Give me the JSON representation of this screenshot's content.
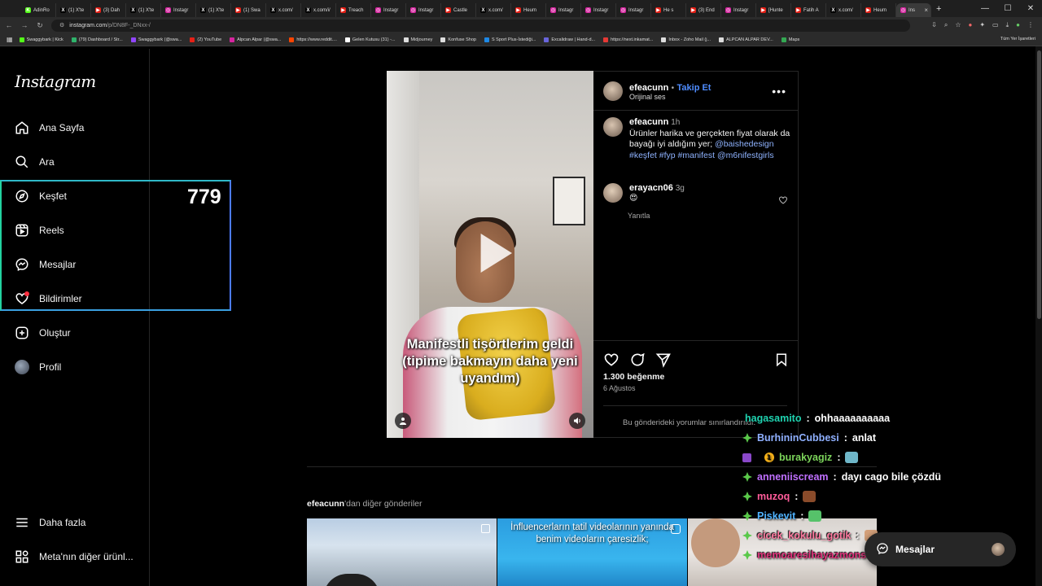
{
  "browser": {
    "tabs": [
      {
        "label": "AdinRo",
        "color": "#53fc18",
        "glyph": "K"
      },
      {
        "label": "(1) X'te",
        "color": "#000000",
        "glyph": "X"
      },
      {
        "label": "(3) Dah",
        "color": "#e62117",
        "glyph": "▶"
      },
      {
        "label": "(1) X'te",
        "color": "#000000",
        "glyph": "X"
      },
      {
        "label": "Instagr",
        "color": "#d6249f",
        "glyph": "◎"
      },
      {
        "label": "(1) X'te",
        "color": "#000000",
        "glyph": "X"
      },
      {
        "label": "(1) Swa",
        "color": "#e62117",
        "glyph": "▶"
      },
      {
        "label": "x.com/",
        "color": "#000000",
        "glyph": "X"
      },
      {
        "label": "x.com/i/",
        "color": "#000000",
        "glyph": "X"
      },
      {
        "label": "Treach",
        "color": "#e62117",
        "glyph": "▶"
      },
      {
        "label": "Instagr",
        "color": "#d6249f",
        "glyph": "◎"
      },
      {
        "label": "Instagr",
        "color": "#d6249f",
        "glyph": "◎"
      },
      {
        "label": "Castle",
        "color": "#e62117",
        "glyph": "▶"
      },
      {
        "label": "x.com/",
        "color": "#000000",
        "glyph": "X"
      },
      {
        "label": "Heum",
        "color": "#e62117",
        "glyph": "▶"
      },
      {
        "label": "Instagr",
        "color": "#d6249f",
        "glyph": "◎"
      },
      {
        "label": "Instagr",
        "color": "#d6249f",
        "glyph": "◎"
      },
      {
        "label": "Instagr",
        "color": "#d6249f",
        "glyph": "◎"
      },
      {
        "label": "He s",
        "color": "#e62117",
        "glyph": "▶"
      },
      {
        "label": "(3) End",
        "color": "#e62117",
        "glyph": "▶"
      },
      {
        "label": "Instagr",
        "color": "#d6249f",
        "glyph": "◎"
      },
      {
        "label": "[Hunte",
        "color": "#e62117",
        "glyph": "▶"
      },
      {
        "label": "Fatih A",
        "color": "#e62117",
        "glyph": "▶"
      },
      {
        "label": "x.com/",
        "color": "#000000",
        "glyph": "X"
      },
      {
        "label": "Heum",
        "color": "#e62117",
        "glyph": "▶"
      },
      {
        "label": "Ins",
        "color": "#d6249f",
        "glyph": "◎",
        "active": true
      }
    ],
    "url_host": "instagram.com",
    "url_path": "/p/DN8F-_DNxx-/",
    "bookmarks": [
      {
        "label": "Swaggybark | Kick",
        "color": "#53fc18"
      },
      {
        "label": "(79) Dashboard / Str...",
        "color": "#2fb36b"
      },
      {
        "label": "Swaggybark (@swa...",
        "color": "#9146ff"
      },
      {
        "label": "(2) YouTube",
        "color": "#e62117"
      },
      {
        "label": "Alpcan Alpar (@swa...",
        "color": "#d6249f"
      },
      {
        "label": "https://www.reddit....",
        "color": "#ff4500"
      },
      {
        "label": "Gelen Kutusu (31) -...",
        "color": "#ffffff"
      },
      {
        "label": "Midjourney",
        "color": "#dddddd"
      },
      {
        "label": "Konfuse Shop",
        "color": "#dddddd"
      },
      {
        "label": "S Sport Plus-İstediği...",
        "color": "#1e88e5"
      },
      {
        "label": "Excalidraw | Hand-d...",
        "color": "#6965db"
      },
      {
        "label": "https://next.inkamat...",
        "color": "#e53935"
      },
      {
        "label": "Inbox - Zoho Mail (j...",
        "color": "#dddddd"
      },
      {
        "label": "ALPCAN ALPAR DEV...",
        "color": "#dddddd"
      },
      {
        "label": "Maps",
        "color": "#34a853"
      }
    ],
    "all_bookmarks": "Tüm Yer İşaretleri"
  },
  "sidebar": {
    "logo": "Instagram",
    "items": [
      {
        "label": "Ana Sayfa",
        "icon": "home-icon"
      },
      {
        "label": "Ara",
        "icon": "search-icon"
      },
      {
        "label": "Keşfet",
        "icon": "compass-icon"
      },
      {
        "label": "Reels",
        "icon": "reels-icon"
      },
      {
        "label": "Mesajlar",
        "icon": "messenger-icon"
      },
      {
        "label": "Bildirimler",
        "icon": "heart-icon"
      },
      {
        "label": "Oluştur",
        "icon": "plus-square-icon"
      },
      {
        "label": "Profil",
        "icon": "avatar"
      }
    ],
    "more": "Daha fazla",
    "meta": "Meta'nın diğer ürünl..."
  },
  "overlay": {
    "count": "779"
  },
  "post": {
    "username": "efeacunn",
    "follow": "Takip Et",
    "separator": "•",
    "audio": "Orijinal ses",
    "video_caption": "Manifestli tişörtlerim geldi (tipime bakmayın daha yeni uyandım)",
    "caption_time": "1h",
    "caption_text": "Ürünler harika ve gerçekten fiyat olarak da bayağı iyi aldığım yer;",
    "caption_links": "@baishedesign #keşfet #fyp #manifest @m6nifestgirls",
    "comment_user": "erayacn06",
    "comment_time": "3g",
    "comment_emoji": "😍",
    "reply": "Yanıtla",
    "likes": "1.300 beğenme",
    "date": "6 Ağustos",
    "comments_limited": "Bu gönderideki yorumlar sınırlandırıldı."
  },
  "more_posts": {
    "user": "efeacunn",
    "suffix": "'dan diğer gönderiler",
    "thumb2_text": "İnfluencerların tatil videolarının yanında benim videoların çaresizlik;"
  },
  "chat": [
    {
      "user": "hagasamito",
      "msg": "ohhaaaaaaaaaa",
      "color": "#1fd3b0",
      "badge": "none"
    },
    {
      "user": "BurhininCubbesi",
      "msg": "anlat",
      "color": "#8fb0ff",
      "badge": "gem"
    },
    {
      "user": "burakyagiz",
      "msg": "",
      "color": "#7bd35a",
      "badge": "cube-coin",
      "coin": "1",
      "emote": "#6fb7c9"
    },
    {
      "user": "anneniiscream",
      "msg": "dayı cago bile çözdü",
      "color": "#c070ff",
      "badge": "gem"
    },
    {
      "user": "muzoq",
      "msg": "",
      "color": "#ff5c9a",
      "badge": "gem",
      "emote": "#8a4b2a"
    },
    {
      "user": "Piskevit",
      "msg": "",
      "color": "#4fb3ff",
      "badge": "gem",
      "emote": "#56c26a"
    },
    {
      "user": "cicek_kokulu_gotik",
      "msg": "",
      "color": "#ff7aa0",
      "badge": "gem",
      "emote": "#d4a07a"
    },
    {
      "user": "memoaresihayazmonster",
      "msg": "",
      "color": "#e0307a",
      "badge": "gem",
      "emote": "#6bd16b"
    }
  ],
  "messages_pill": {
    "label": "Mesajlar"
  }
}
